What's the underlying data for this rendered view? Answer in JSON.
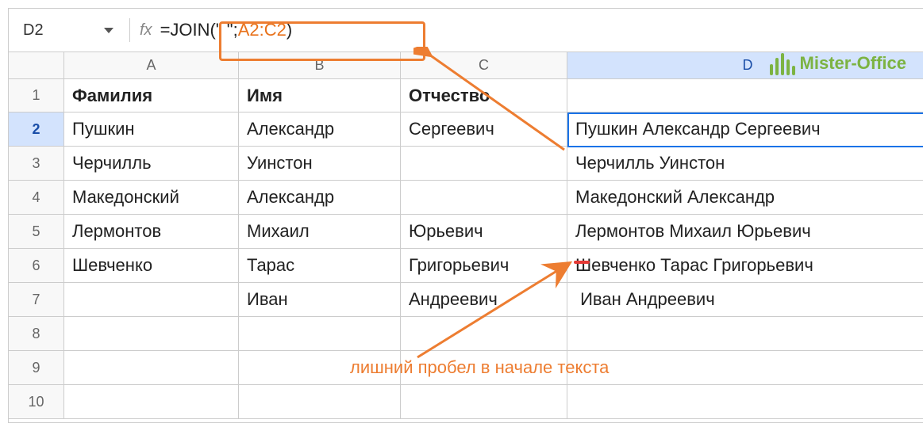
{
  "nameBox": "D2",
  "formula": {
    "prefix": "=JOIN(\"  \";",
    "ref": "A2:C2",
    "suffix": ")"
  },
  "columns": [
    "A",
    "B",
    "C",
    "D"
  ],
  "selectedCol": "D",
  "selectedRow": 2,
  "headers": {
    "A": "Фамилия",
    "B": "Имя",
    "C": "Отчество",
    "D": ""
  },
  "rows": [
    {
      "n": 1,
      "A": "Фамилия",
      "B": "Имя",
      "C": "Отчество",
      "D": "",
      "header": true
    },
    {
      "n": 2,
      "A": "Пушкин",
      "B": "Александр",
      "C": "Сергеевич",
      "D": "Пушкин Александр Сергеевич"
    },
    {
      "n": 3,
      "A": "Черчилль",
      "B": "Уинстон",
      "C": "",
      "D": "Черчилль Уинстон"
    },
    {
      "n": 4,
      "A": "Македонский",
      "B": "Александр",
      "C": "",
      "D": "Македонский Александр"
    },
    {
      "n": 5,
      "A": "Лермонтов",
      "B": "Михаил",
      "C": "Юрьевич",
      "D": "Лермонтов Михаил Юрьевич"
    },
    {
      "n": 6,
      "A": "Шевченко",
      "B": "Тарас",
      "C": "Григорьевич",
      "D": "Шевченко Тарас Григорьевич"
    },
    {
      "n": 7,
      "A": "",
      "B": "Иван",
      "C": "Андреевич",
      "D": " Иван Андреевич"
    },
    {
      "n": 8,
      "A": "",
      "B": "",
      "C": "",
      "D": ""
    },
    {
      "n": 9,
      "A": "",
      "B": "",
      "C": "",
      "D": ""
    },
    {
      "n": 10,
      "A": "",
      "B": "",
      "C": "",
      "D": ""
    }
  ],
  "annotation": "лишний пробел в начале текста",
  "logo": "Mister-Office",
  "fxLabel": "fx",
  "chart_data": null
}
